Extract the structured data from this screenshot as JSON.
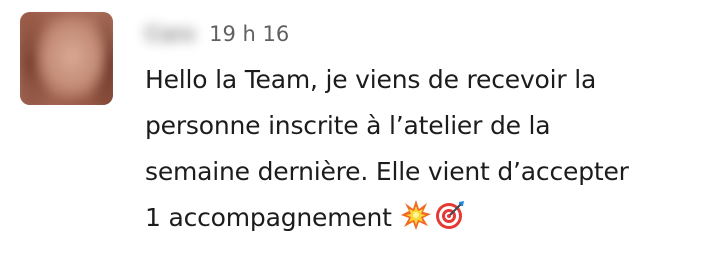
{
  "message": {
    "author": "Caro",
    "timestamp": "19 h 16",
    "lines": [
      "Hello la Team, je viens de recevoir la",
      "personne inscrite à l’atelier de la",
      "semaine dernière. Elle vient d’accepter",
      "1 accompagnement"
    ],
    "emojis": [
      "collision-icon",
      "direct-hit-icon"
    ]
  }
}
